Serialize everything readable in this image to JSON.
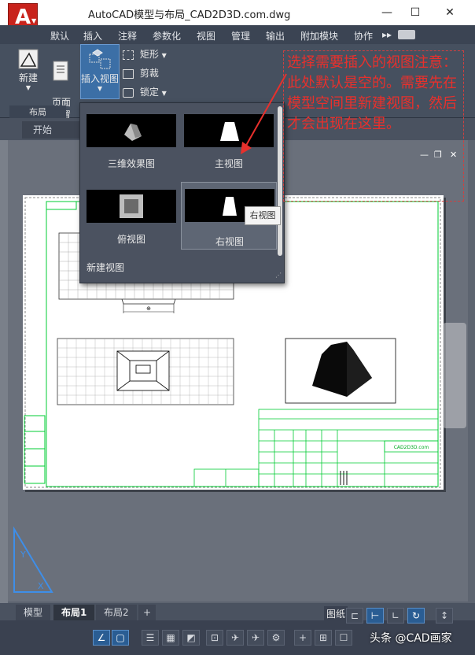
{
  "window": {
    "title": "AutoCAD模型与布局_CAD2D3D.com.dwg",
    "logo_letter": "A",
    "minimize": "—",
    "maximize": "☐",
    "close": "✕"
  },
  "ribbon_tabs": [
    "默认",
    "插入",
    "注释",
    "参数化",
    "视图",
    "管理",
    "输出",
    "附加模块",
    "协作",
    "▸▸"
  ],
  "ribbon": {
    "new_label": "新建",
    "page_setup_label": "页面\n设置",
    "insert_view_label": "插入视图",
    "rectangle_label": "矩形",
    "clip_label": "剪裁",
    "lock_label": "锁定",
    "panel_label": "布局"
  },
  "doc_tabs": {
    "start": "开始"
  },
  "gallery": {
    "items": [
      {
        "label": "三维效果图"
      },
      {
        "label": "主视图"
      },
      {
        "label": "俯视图"
      },
      {
        "label": "右视图"
      }
    ],
    "new_view": "新建视图",
    "tooltip": "右视图"
  },
  "annotation": {
    "text": "选择需要插入的视图注意：此处默认是空的。需要先在模型空间里新建视图，然后才会出现在这里。"
  },
  "drawing": {
    "title_block_site": "CAD2D3D.com",
    "dim_center": "⊕"
  },
  "layout_tabs": [
    {
      "label": "模型",
      "active": false
    },
    {
      "label": "布局1",
      "active": true
    },
    {
      "label": "布局2",
      "active": false
    },
    {
      "label": "+",
      "active": false
    }
  ],
  "statusbar": {
    "paper_label": "图纸",
    "watermark": "头条 @CAD画家"
  }
}
